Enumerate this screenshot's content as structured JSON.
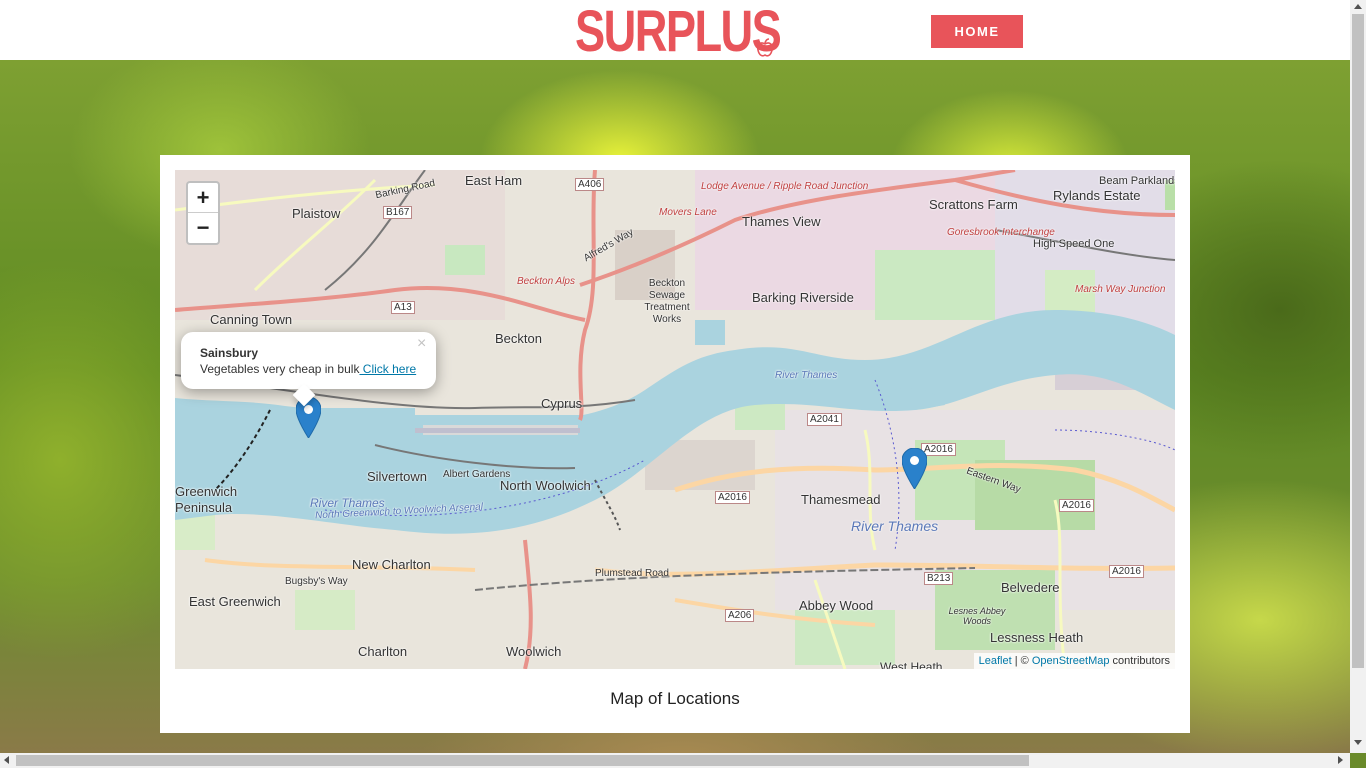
{
  "header": {
    "logo_text": "SURPLUS",
    "home_label": "HOME",
    "brand_color": "#e8545a"
  },
  "map": {
    "zoom_in": "+",
    "zoom_out": "−",
    "popup": {
      "title": "Sainsbury",
      "description": "Vegetables very cheap in bulk",
      "link": " Click here",
      "close": "×"
    },
    "attribution": {
      "leaflet": "Leaflet",
      "separator": " | © ",
      "osm": "OpenStreetMap",
      "suffix": " contributors"
    },
    "labels": [
      "East Ham",
      "Plaistow",
      "Canning Town",
      "Beckton",
      "Cyprus",
      "Silvertown",
      "North Woolwich",
      "Greenwich",
      "Peninsula",
      "New Charlton",
      "East Greenwich",
      "Charlton",
      "Woolwich",
      "Thames View",
      "Barking Riverside",
      "Scrattons Farm",
      "Rylands Estate",
      "Beam Parklands",
      "Thamesmead",
      "Abbey Wood",
      "Belvedere",
      "Lessness Heath",
      "West Heath",
      "Beckton Sewage Treatment Works",
      "River Thames",
      "River Thames",
      "River Thames",
      "North Greenwich to Woolwich Arsenal",
      "A406",
      "B167",
      "A13",
      "A2041",
      "A2016",
      "A2016",
      "A2016",
      "A2016",
      "A206",
      "B213",
      "Barking Road",
      "Movers Lane",
      "Alfred's Way",
      "Beckton Alps",
      "Albert Gardens",
      "Plumstead Road",
      "Eastern Way",
      "Bugsby's Way",
      "Lodge Avenue / Ripple Road Junction",
      "Goresbrook Interchange",
      "High Speed One",
      "Marsh Way Junction",
      "Lesnes Abbey Woods"
    ],
    "markers": [
      "Sainsbury",
      "Thamesmead location"
    ]
  },
  "caption": "Map of Locations"
}
